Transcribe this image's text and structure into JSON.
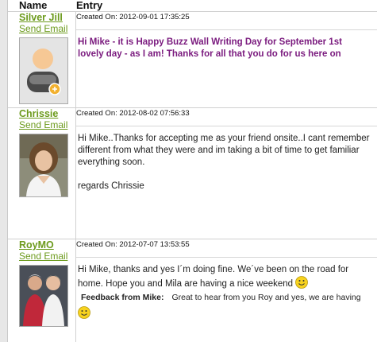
{
  "table": {
    "col_name": "Name",
    "col_entry": "Entry"
  },
  "entries": [
    {
      "name": "Silver Jill",
      "send_email": "Send Email",
      "created": "Created On: 2012-09-01 17:35:25",
      "line1": "Hi Mike - it is Happy Buzz Wall Writing Day for September 1st",
      "line2": "lovely day - as I am! Thanks for all that you do for us here on",
      "avatar": "default-avatar-icon"
    },
    {
      "name": "Chrissie",
      "send_email": "Send Email",
      "created": "Created On: 2012-08-02 07:56:33",
      "line1": "Hi Mike..Thanks for accepting me as your friend onsite..I cant remember",
      "line2": "different from what they were and im taking a bit of time to get familiar",
      "line3": "everything soon.",
      "line4": "regards Chrissie"
    },
    {
      "name": "RoyMO",
      "send_email": "Send Email",
      "created": "Created On: 2012-07-07 13:53:55",
      "line1": "Hi Mike, thanks and yes I´m doing fine. We´ve been on the road for",
      "line2": "home. Hope you and Mila are having a nice weekend",
      "feedback_label": "Feedback from Mike:",
      "feedback_text": "Great to hear from you Roy and yes, we are having"
    }
  ],
  "colors": {
    "link_green": "#6c9a1c",
    "message_purple": "#7a1a7e"
  }
}
